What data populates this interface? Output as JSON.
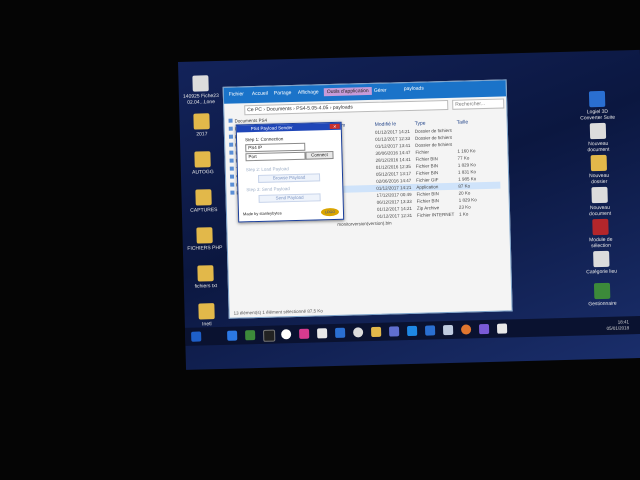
{
  "desktop_icons": [
    {
      "label": "140925 Fiche23 02.04...Lone",
      "kind": "file"
    },
    {
      "label": "2017",
      "kind": "folder"
    },
    {
      "label": "AUTOGG",
      "kind": "folder"
    },
    {
      "label": "CAPTURES",
      "kind": "folder"
    },
    {
      "label": "FICHIERS PHP",
      "kind": "folder"
    },
    {
      "label": "fichiers txt",
      "kind": "folder"
    },
    {
      "label": "Inetl",
      "kind": "folder"
    }
  ],
  "right_icons": [
    {
      "label": "Logiel 3D Converter Suite",
      "kind": "app-blue"
    },
    {
      "label": "Nouveau document",
      "kind": "file"
    },
    {
      "label": "Nouveau dossier",
      "kind": "folder"
    },
    {
      "label": "Nouveau document",
      "kind": "file"
    },
    {
      "label": "Module de sélection",
      "kind": "app-red"
    },
    {
      "label": "Catégorie lieu",
      "kind": "file"
    },
    {
      "label": "Gestionnaire",
      "kind": "app-green"
    }
  ],
  "explorer": {
    "title": "payloads",
    "tabs": [
      "Fichier",
      "Accueil",
      "Partage",
      "Affichage",
      "Outils d'application",
      "Gérer"
    ],
    "address": "Ce PC › Documents › PS4-5.05-4.05 › payloads",
    "search_placeholder": "Rechercher...",
    "columns": {
      "name": "Nom",
      "modified": "Modifié le",
      "type": "Type",
      "size": "Taille"
    },
    "rows": [
      {
        "name": "",
        "modified": "01/12/2017 14:21",
        "type": "Dossier de fichiers",
        "size": ""
      },
      {
        "name": "",
        "modified": "01/12/2017 12:33",
        "type": "Dossier de fichiers",
        "size": ""
      },
      {
        "name": "",
        "modified": "01/12/2017 13:41",
        "type": "Dossier de fichiers",
        "size": ""
      },
      {
        "name": "",
        "modified": "30/06/2016 14:47",
        "type": "Fichier",
        "size": "1 160 Ko"
      },
      {
        "name": "",
        "modified": "28/12/2016 14:41",
        "type": "Fichier BIN",
        "size": "77 Ko"
      },
      {
        "name": "",
        "modified": "01/12/2016 12:35",
        "type": "Fichier BIN",
        "size": "1 829 Ko"
      },
      {
        "name": "",
        "modified": "05/12/2017 13:17",
        "type": "Fichier BIN",
        "size": "1 831 Ko"
      },
      {
        "name": "",
        "modified": "02/06/2016 14:47",
        "type": "Fichier GIF",
        "size": "1 985 Ko"
      },
      {
        "name": "",
        "modified": "01/12/2017 14:21",
        "type": "Application",
        "size": "87 Ko"
      },
      {
        "name": "",
        "modified": "17/12/2017 00:49",
        "type": "Fichier BIN",
        "size": "20 Ko"
      },
      {
        "name": "",
        "modified": "06/12/2017 13:33",
        "type": "Fichier BIN",
        "size": "1 829 Ko"
      },
      {
        "name": "",
        "modified": "01/12/2017 14:21",
        "type": "Zip Archive",
        "size": "23 Ko"
      },
      {
        "name": "",
        "modified": "01/12/2017 12:31",
        "type": "Fichier INTERNET",
        "size": "1 Ko"
      },
      {
        "name": "monitorversion(version).bin",
        "modified": "",
        "type": "",
        "size": ""
      }
    ],
    "nav_items": [
      "Documents PS4",
      "PS4-5.05-4.05",
      "PlayStation 4 ...",
      "Documents",
      "Images",
      "Musique",
      "Téléchargements",
      "Vidéos",
      "RECOVERY",
      "Réseau"
    ],
    "status": "13 élément(s)    1 élément sélectionné  87,5 Ko"
  },
  "dialog": {
    "title": "PS4 Payload Sender",
    "close_label": "✕",
    "step1": "Step 1: Connection",
    "ip_value": "PS4 IP",
    "port_value": "Port",
    "connect_label": "Connect",
    "step2": "Step 2: Load Payload",
    "browse_label": "Browse Payload",
    "step3": "Step 3: Send Payload",
    "send_label": "Send Payload",
    "footer": "Made by stanleybytes",
    "logo_text": "LOGO"
  },
  "taskbar": {
    "time": "18:41",
    "date": "05/01/2018"
  }
}
